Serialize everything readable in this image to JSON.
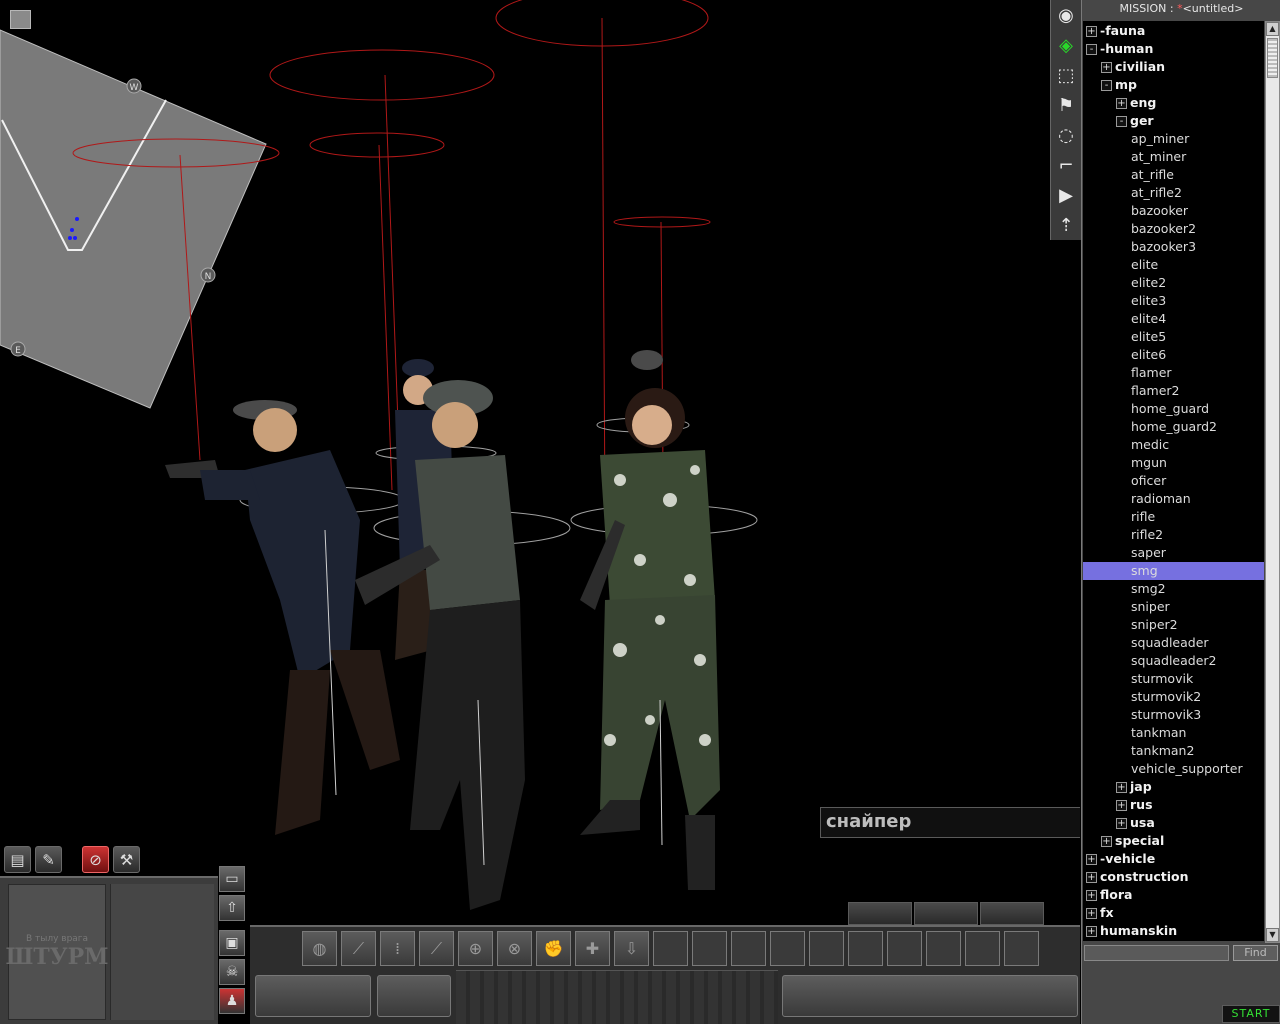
{
  "mission_title": {
    "label": "MISSION : ",
    "modified": "*",
    "name": "<untitled>"
  },
  "unit_name_label": "снайпер",
  "find": {
    "value": "",
    "button": "Find"
  },
  "start_button": "START",
  "hud_logo": {
    "small": "В тылу врага",
    "big": "ШТУРМ"
  },
  "tools": [
    "eye-icon",
    "edit-entity-icon",
    "selection-icon",
    "flag-icon",
    "circle-icon",
    "path-icon",
    "camera-icon",
    "upload-icon"
  ],
  "tree": [
    {
      "label": "-fauna",
      "expander": "+"
    },
    {
      "label": "-human",
      "expander": "-"
    },
    {
      "label": "civilian",
      "expander": "+"
    },
    {
      "label": "mp",
      "expander": "-"
    },
    {
      "label": "eng",
      "expander": "+"
    },
    {
      "label": "ger",
      "expander": "-"
    },
    {
      "label": "ap_miner"
    },
    {
      "label": "at_miner"
    },
    {
      "label": "at_rifle"
    },
    {
      "label": "at_rifle2"
    },
    {
      "label": "bazooker"
    },
    {
      "label": "bazooker2"
    },
    {
      "label": "bazooker3"
    },
    {
      "label": "elite"
    },
    {
      "label": "elite2"
    },
    {
      "label": "elite3"
    },
    {
      "label": "elite4"
    },
    {
      "label": "elite5"
    },
    {
      "label": "elite6"
    },
    {
      "label": "flamer"
    },
    {
      "label": "flamer2"
    },
    {
      "label": "home_guard"
    },
    {
      "label": "home_guard2"
    },
    {
      "label": "medic"
    },
    {
      "label": "mgun"
    },
    {
      "label": "oficer"
    },
    {
      "label": "radioman"
    },
    {
      "label": "rifle"
    },
    {
      "label": "rifle2"
    },
    {
      "label": "saper"
    },
    {
      "label": "smg",
      "selected": true
    },
    {
      "label": "smg2"
    },
    {
      "label": "sniper"
    },
    {
      "label": "sniper2"
    },
    {
      "label": "squadleader"
    },
    {
      "label": "squadleader2"
    },
    {
      "label": "sturmovik"
    },
    {
      "label": "sturmovik2"
    },
    {
      "label": "sturmovik3"
    },
    {
      "label": "tankman"
    },
    {
      "label": "tankman2"
    },
    {
      "label": "vehicle_supporter"
    },
    {
      "label": "jap",
      "expander": "+"
    },
    {
      "label": "rus",
      "expander": "+"
    },
    {
      "label": "usa",
      "expander": "+"
    },
    {
      "label": "special",
      "expander": "+"
    },
    {
      "label": "-vehicle",
      "expander": "+"
    },
    {
      "label": "construction",
      "expander": "+"
    },
    {
      "label": "flora",
      "expander": "+"
    },
    {
      "label": "fx",
      "expander": "+"
    },
    {
      "label": "humanskin",
      "expander": "+"
    }
  ],
  "minimap_markers": [
    "W",
    "N",
    "E"
  ],
  "colors": {
    "selection": "#7670e0",
    "start_text": "#34e034",
    "guide_red": "#b01818"
  }
}
